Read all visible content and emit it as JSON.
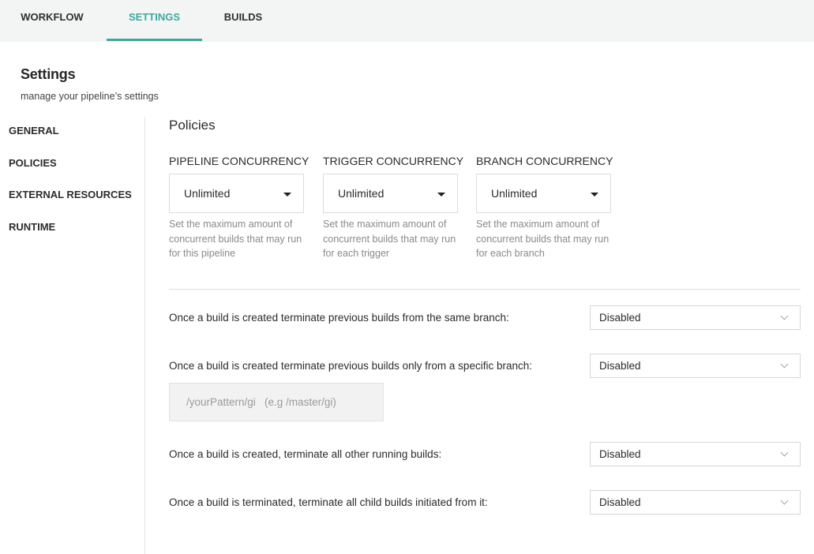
{
  "tabs": [
    {
      "label": "WORKFLOW"
    },
    {
      "label": "SETTINGS",
      "active": true
    },
    {
      "label": "BUILDS"
    }
  ],
  "page": {
    "title": "Settings",
    "subtitle": "manage your pipeline’s settings"
  },
  "nav": [
    {
      "label": "GENERAL"
    },
    {
      "label": "POLICIES"
    },
    {
      "label": "EXTERNAL RESOURCES"
    },
    {
      "label": "RUNTIME"
    }
  ],
  "section": {
    "title": "Policies"
  },
  "concurrency": [
    {
      "label": "PIPELINE CONCURRENCY",
      "value": "Unlimited",
      "help": "Set the maximum amount of concurrent builds that may run for this pipeline"
    },
    {
      "label": "TRIGGER CONCURRENCY",
      "value": "Unlimited",
      "help": "Set the maximum amount of concurrent builds that may run for each trigger"
    },
    {
      "label": "BRANCH CONCURRENCY",
      "value": "Unlimited",
      "help": "Set the maximum amount of concurrent builds that may run for each branch"
    }
  ],
  "rules": [
    {
      "label": "Once a build is created terminate previous builds from the same branch:",
      "value": "Disabled"
    },
    {
      "label": "Once a build is created terminate previous builds only from a specific branch:",
      "value": "Disabled"
    },
    {
      "label": "Once a build is created, terminate all other running builds:",
      "value": "Disabled"
    },
    {
      "label": "Once a build is terminated, terminate all child builds initiated from it:",
      "value": "Disabled"
    }
  ],
  "pattern": {
    "placeholder": "/yourPattern/gi   (e.g /master/gi)",
    "value": ""
  },
  "colors": {
    "accent": "#3ea89d",
    "topbar_bg": "#f3f5f4",
    "help_text": "#8a8a8a"
  }
}
